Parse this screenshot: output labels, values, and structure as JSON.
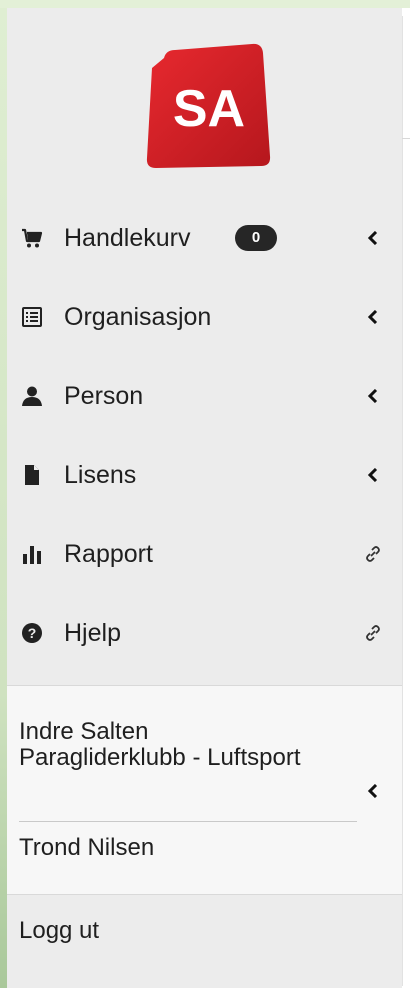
{
  "brand": {
    "logo_text": "SA",
    "logo_color": "#d9232a"
  },
  "nav": {
    "items": [
      {
        "label": "Handlekurv",
        "icon": "cart-icon",
        "badge": "0",
        "trail": "chevron-left-icon"
      },
      {
        "label": "Organisasjon",
        "icon": "list-alt-icon",
        "trail": "chevron-left-icon"
      },
      {
        "label": "Person",
        "icon": "user-icon",
        "trail": "chevron-left-icon"
      },
      {
        "label": "Lisens",
        "icon": "file-icon",
        "trail": "chevron-left-icon"
      },
      {
        "label": "Rapport",
        "icon": "bar-chart-icon",
        "trail": "link-icon"
      },
      {
        "label": "Hjelp",
        "icon": "question-circle-icon",
        "trail": "link-icon"
      }
    ]
  },
  "account": {
    "org_name": "Indre Salten Paragliderklubb - Luftsport",
    "user_name": "Trond Nilsen",
    "logout_label": "Logg ut"
  }
}
